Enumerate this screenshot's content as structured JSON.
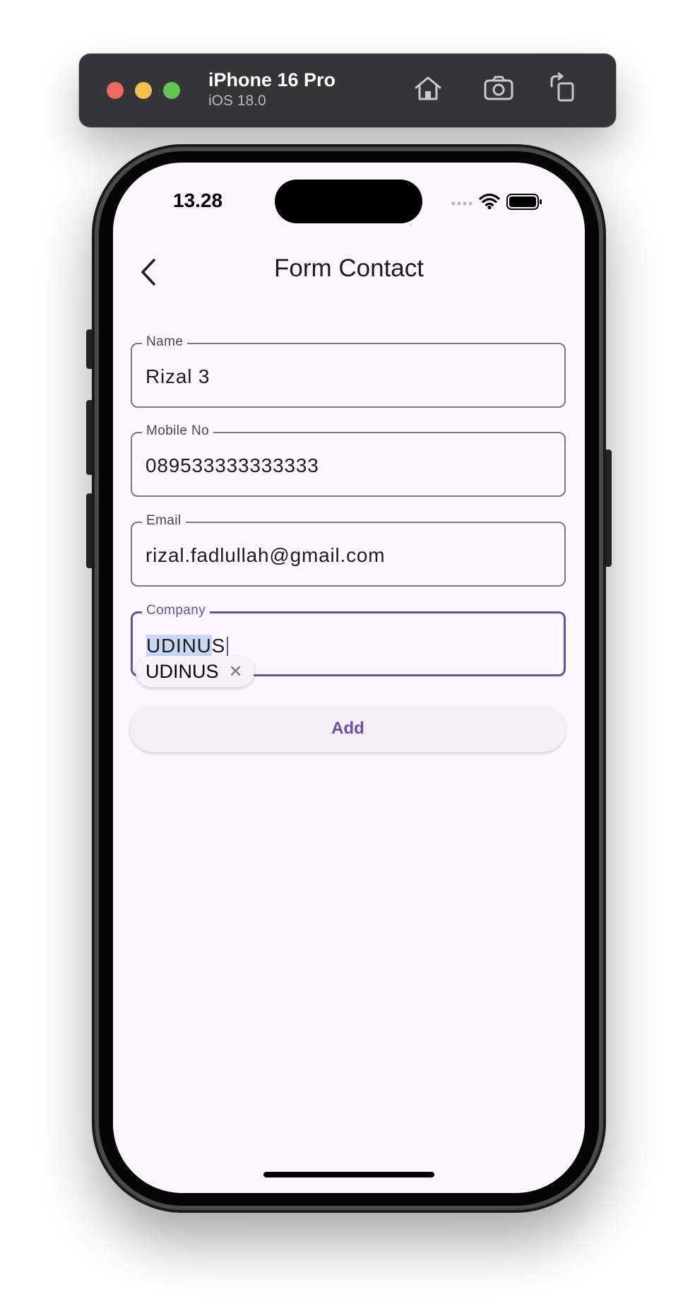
{
  "simulator": {
    "device_name": "iPhone 16 Pro",
    "os_version": "iOS 18.0",
    "buttons": [
      "home-icon",
      "screenshot-icon",
      "rotate-icon"
    ]
  },
  "status_bar": {
    "time": "13.28"
  },
  "app_bar": {
    "title": "Form Contact"
  },
  "form": {
    "name": {
      "label": "Name",
      "value": "Rizal 3"
    },
    "mobile": {
      "label": "Mobile No",
      "value": "089533333333333"
    },
    "email": {
      "label": "Email",
      "value": "rizal.fadlullah@gmail.com"
    },
    "company": {
      "label": "Company",
      "value_selected": "UDINU",
      "value_rest": "S"
    },
    "suggestion": {
      "text": "UDINUS"
    },
    "add_label": "Add"
  },
  "colors": {
    "accent": "#6750a4",
    "background": "#fcf7fc",
    "selection": "#c9d6f4"
  }
}
